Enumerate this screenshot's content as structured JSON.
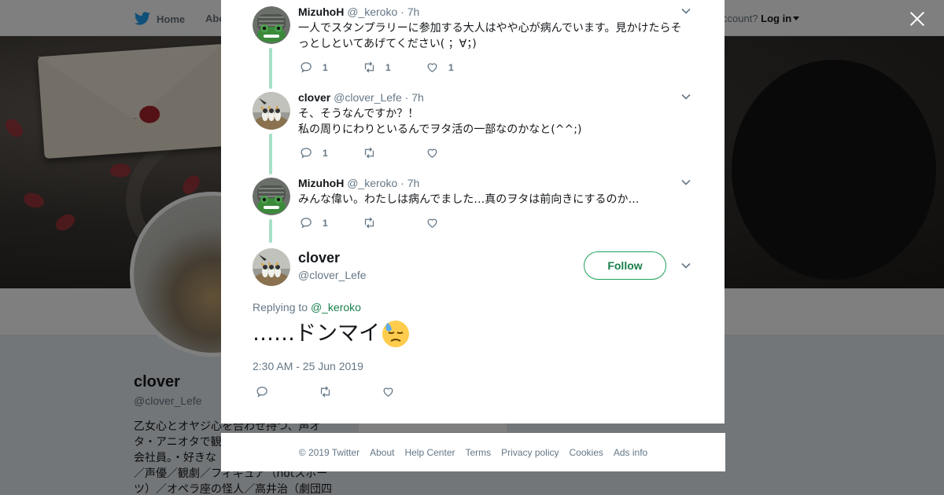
{
  "topnav": {
    "home": "Home",
    "about": "Abo",
    "account_prefix": "ccount?",
    "login": "Log in"
  },
  "profile": {
    "name": "clover",
    "handle": "@clover_Lefe",
    "bio_lines": [
      "乙女心とオヤジ心を合わせ持つ、声オ",
      "タ・アニオタで観",
      "会社員。・好きな",
      "／声優／観劇／フィギュア（notスポー",
      "ツ）／オペラ座の怪人／高井治（劇団四"
    ],
    "card_text": "Ads info"
  },
  "replies": [
    {
      "name": "MizuhoH",
      "handle": "@_keroko",
      "dot": "·",
      "time": "7h",
      "text": "一人でスタンプラリーに参加する大人はやや心が病んでいます。見かけたらそっとしといてあげてください( ；∀；)",
      "reply_count": "1",
      "retweet_count": "1",
      "like_count": "1",
      "avatar": "frog"
    },
    {
      "name": "clover",
      "handle": "@clover_Lefe",
      "dot": "·",
      "time": "7h",
      "text_lines": [
        "そ、そうなんですか？！",
        "私の周りにわりといるんでヲタ活の一部なのかなと(^^;)"
      ],
      "reply_count": "1",
      "retweet_count": "",
      "like_count": "",
      "avatar": "birds"
    },
    {
      "name": "MizuhoH",
      "handle": "@_keroko",
      "dot": "·",
      "time": "7h",
      "text": "みんな偉い。わたしは病んでました…真のヲタは前向きにするのか…",
      "reply_count": "1",
      "retweet_count": "",
      "like_count": "",
      "avatar": "frog"
    }
  ],
  "main_tweet": {
    "name": "clover",
    "handle": "@clover_Lefe",
    "follow_label": "Follow",
    "replying_prefix": "Replying to",
    "replying_handle": "@_keroko",
    "text": "……ドンマイ",
    "emoji": "downcast-face-with-sweat",
    "timestamp": "2:30 AM - 25 Jun 2019"
  },
  "footer": [
    "© 2019 Twitter",
    "About",
    "Help Center",
    "Terms",
    "Privacy policy",
    "Cookies",
    "Ads info"
  ],
  "colors": {
    "accent": "#1a7f4b",
    "thread_line": "#a6e0c6",
    "muted": "#657786",
    "twitter_blue": "#1da1f2"
  },
  "icons": [
    "twitter-bird-icon",
    "close-icon",
    "reply-icon",
    "retweet-icon",
    "like-icon",
    "chevron-down-icon"
  ]
}
